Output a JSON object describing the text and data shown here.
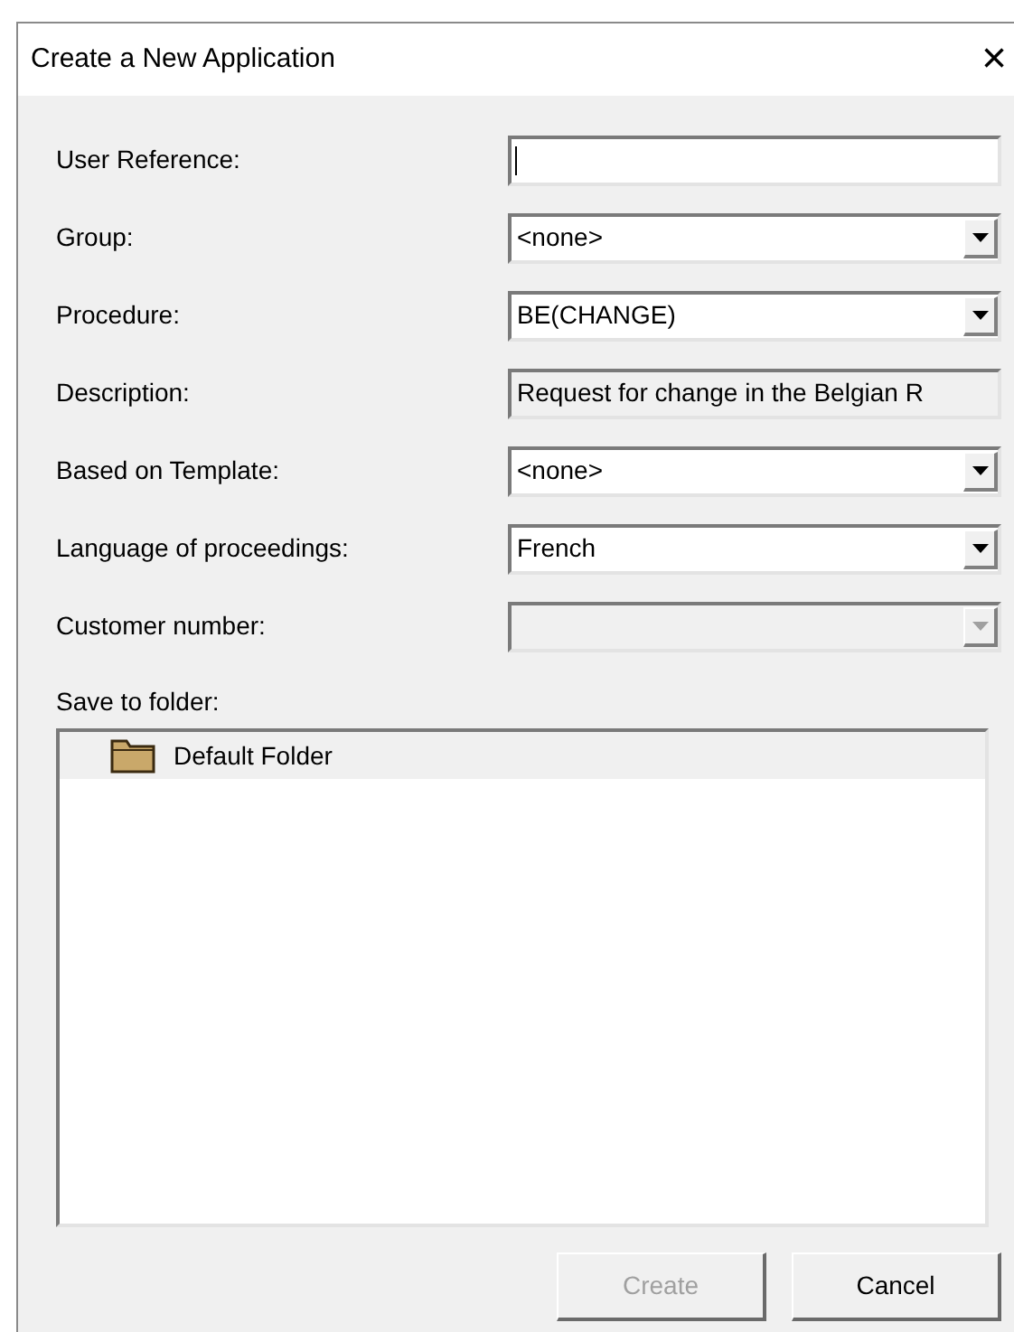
{
  "window": {
    "title": "Create a New Application",
    "close": "×"
  },
  "fields": [
    {
      "label": "User Reference:",
      "kind": "text",
      "focused": true
    },
    {
      "label": "Group:",
      "kind": "combo",
      "value": "<none>",
      "disabled": false
    },
    {
      "label": "Procedure:",
      "kind": "combo",
      "value": "BE(CHANGE)",
      "disabled": false
    },
    {
      "label": "Description:",
      "kind": "readonly",
      "value": "Request for change in the Belgian R"
    },
    {
      "label": "Based on Template:",
      "kind": "combo",
      "value": "<none>",
      "disabled": false
    },
    {
      "label": "Language of proceedings:",
      "kind": "combo",
      "value": "French",
      "disabled": false
    },
    {
      "label": "Customer number:",
      "kind": "combo",
      "disabled": true
    }
  ],
  "folder": {
    "label": "Save to folder:",
    "items": [
      {
        "name": "Default Folder",
        "selected": true
      }
    ]
  },
  "buttons": [
    {
      "label": "Create",
      "disabled": true
    },
    {
      "label": "Cancel",
      "disabled": false
    }
  ]
}
